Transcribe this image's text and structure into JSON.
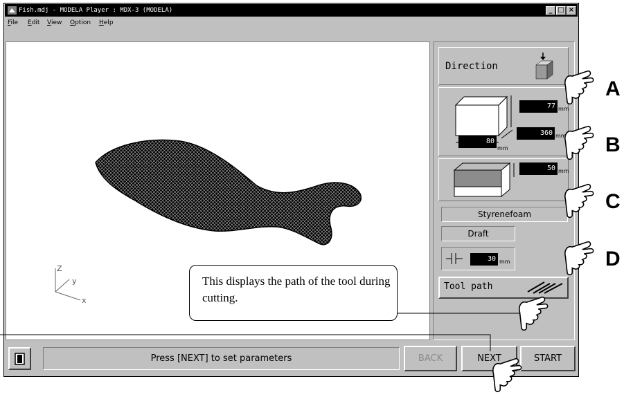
{
  "window": {
    "title": "Fish.mdj - MODELA Player  : MDX-3 (MODELA)",
    "controls": {
      "minimize": "_",
      "maximize": "□",
      "close": "×"
    }
  },
  "menu": [
    "File",
    "Edit",
    "View",
    "Option",
    "Help"
  ],
  "axes": {
    "z": "Z",
    "y": "y",
    "x": "x"
  },
  "panel": {
    "direction_label": "Direction",
    "size": {
      "height": "77",
      "width": "80",
      "depth": "360",
      "unit": "mm"
    },
    "stock": {
      "thickness": "50",
      "unit": "mm"
    },
    "material": "Styrenefoam",
    "quality": "Draft",
    "tool": {
      "value": "30",
      "unit": "mm"
    },
    "tool_path_label": "Tool path"
  },
  "statusbar": {
    "message": "Press [NEXT] to set parameters",
    "back": "BACK",
    "next": "NEXT",
    "start": "START"
  },
  "annotations": {
    "labels": [
      "A",
      "B",
      "C",
      "D"
    ],
    "callout": "This displays the path of the tool during cutting."
  }
}
